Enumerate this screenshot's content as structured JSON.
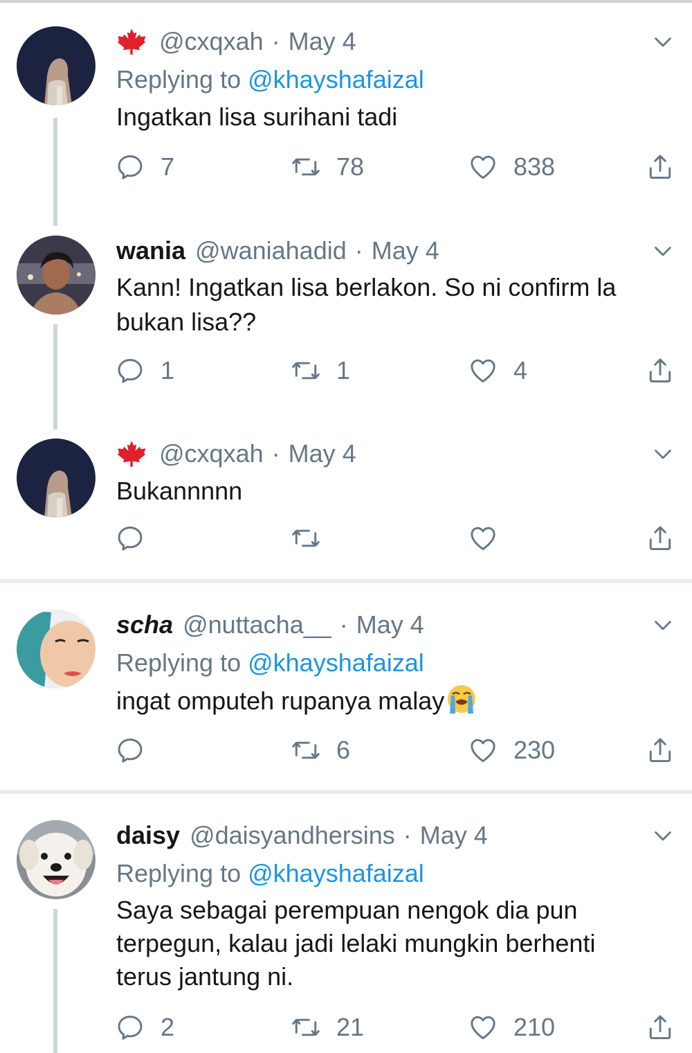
{
  "tweets": [
    {
      "name": "",
      "handle": "@cxqxah",
      "dot": "·",
      "date": "May 4",
      "replying_prefix": "Replying to ",
      "replying_to": "@khayshafaizal",
      "text": "Ingatkan lisa surihani tadi",
      "replies": "7",
      "retweets": "78",
      "likes": "838"
    },
    {
      "name": "wania",
      "handle": "@waniahadid",
      "dot": "·",
      "date": "May 4",
      "text_line1": "Kann! Ingatkan lisa berlakon. So ni confirm la",
      "text_line2": "bukan lisa??",
      "replies": "1",
      "retweets": "1",
      "likes": "4"
    },
    {
      "name": "",
      "handle": "@cxqxah",
      "dot": "·",
      "date": "May 4",
      "text": "Bukannnnn",
      "replies": "",
      "retweets": "",
      "likes": ""
    },
    {
      "name": "scha",
      "handle": "@nuttacha__",
      "dot": "·",
      "date": "May 4",
      "replying_prefix": "Replying to ",
      "replying_to": "@khayshafaizal",
      "text": "ingat omputeh rupanya malay",
      "emoji": "loudly-crying-face-emoji",
      "replies": "",
      "retweets": "6",
      "likes": "230"
    },
    {
      "name": "daisy",
      "handle": "@daisyandhersins",
      "dot": "·",
      "date": "May 4",
      "replying_prefix": "Replying to ",
      "replying_to": "@khayshafaizal",
      "text_line1": "Saya sebagai perempuan nengok dia pun",
      "text_line2": "terpegun, kalau jadi lelaki mungkin berhenti",
      "text_line3": "terus jantung ni.",
      "replies": "2",
      "retweets": "21",
      "likes": "210"
    }
  ],
  "icons": {
    "reply": "reply-icon",
    "retweet": "retweet-icon",
    "like": "heart-icon",
    "share": "share-icon",
    "caret": "chevron-down-icon",
    "flag": "maple-leaf-icon"
  },
  "colors": {
    "text_primary": "#14171a",
    "text_secondary": "#657786",
    "mention": "#1b95e0",
    "thread_line": "#ccd6dd",
    "separator": "#e6ecf0",
    "maple": "#e0202a"
  }
}
